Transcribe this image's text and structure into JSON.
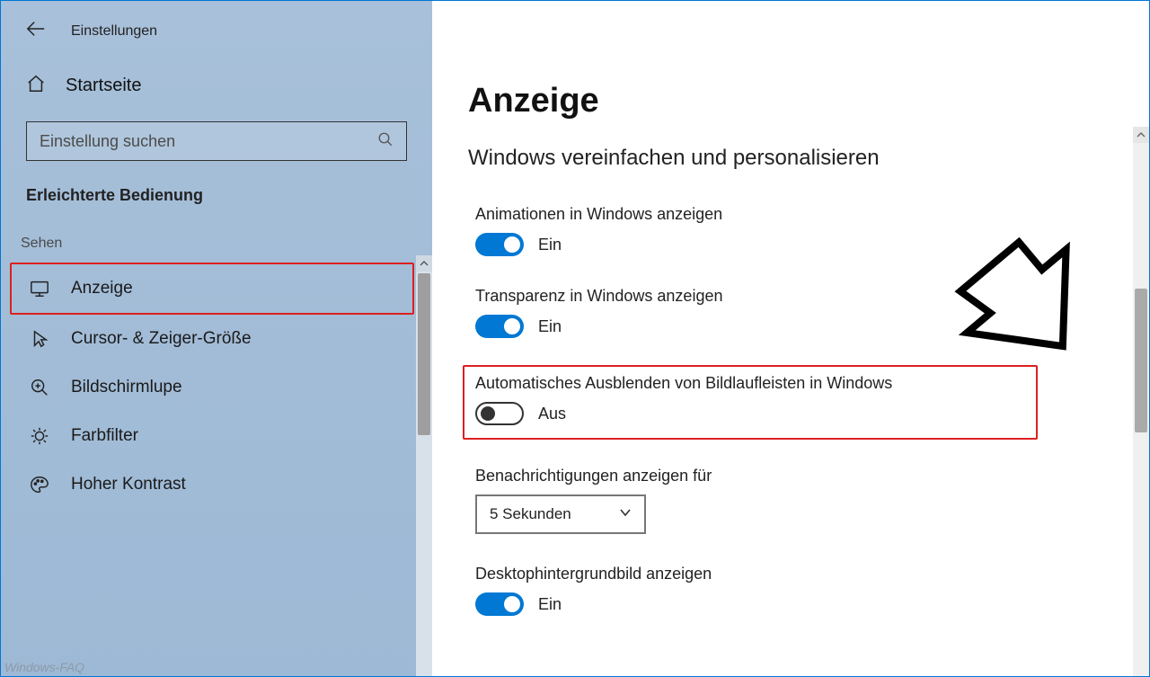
{
  "titlebar": {
    "app_name": "Einstellungen"
  },
  "sidebar": {
    "home_label": "Startseite",
    "search_placeholder": "Einstellung suchen",
    "section_title": "Erleichterte Bedienung",
    "group_label": "Sehen",
    "items": [
      {
        "label": "Anzeige"
      },
      {
        "label": "Cursor- & Zeiger-Größe"
      },
      {
        "label": "Bildschirmlupe"
      },
      {
        "label": "Farbfilter"
      },
      {
        "label": "Hoher Kontrast"
      }
    ]
  },
  "main": {
    "page_title": "Anzeige",
    "subtitle": "Windows vereinfachen und personalisieren",
    "settings": {
      "animations": {
        "label": "Animationen in Windows anzeigen",
        "state_label": "Ein"
      },
      "transparency": {
        "label": "Transparenz in Windows anzeigen",
        "state_label": "Ein"
      },
      "hide_scrollbars": {
        "label": "Automatisches Ausblenden von Bildlaufleisten in Windows",
        "state_label": "Aus"
      },
      "notifications": {
        "label": "Benachrichtigungen anzeigen für",
        "value": "5 Sekunden"
      },
      "desktop_bg": {
        "label": "Desktophintergrundbild anzeigen",
        "state_label": "Ein"
      }
    }
  },
  "watermark": "Windows-FAQ"
}
